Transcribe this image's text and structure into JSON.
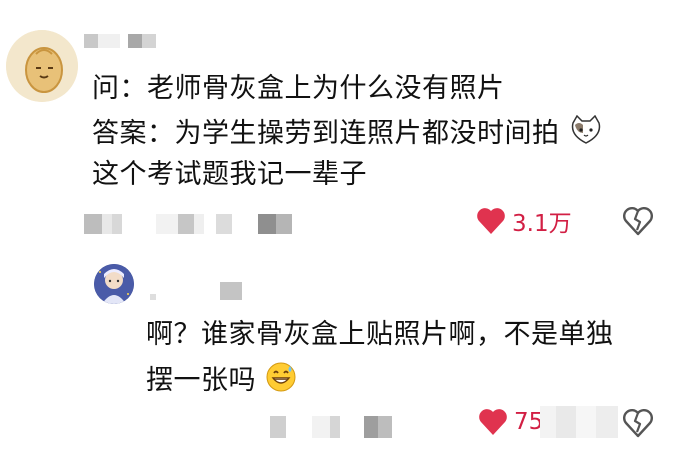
{
  "comment1": {
    "lines": [
      "问：老师骨灰盒上为什么没有照片",
      "答案：为学生操劳到连照片都没时间拍",
      "这个考试题我记一辈子"
    ],
    "like_count": "3.1万",
    "avatar_icon": "potato-avatar-icon",
    "emoji": "cat-face-emoji-icon"
  },
  "reply1": {
    "lines": [
      "啊？谁家骨灰盒上贴照片啊，不是单独",
      "摆一张吗"
    ],
    "like_count": "7520",
    "avatar_icon": "anime-character-avatar-icon",
    "emoji": "grinning-sweat-emoji-icon"
  },
  "colors": {
    "heart": "#e0334f",
    "mosaic_dark": "#9e9e9e",
    "mosaic_light": "#d6d6d6"
  }
}
